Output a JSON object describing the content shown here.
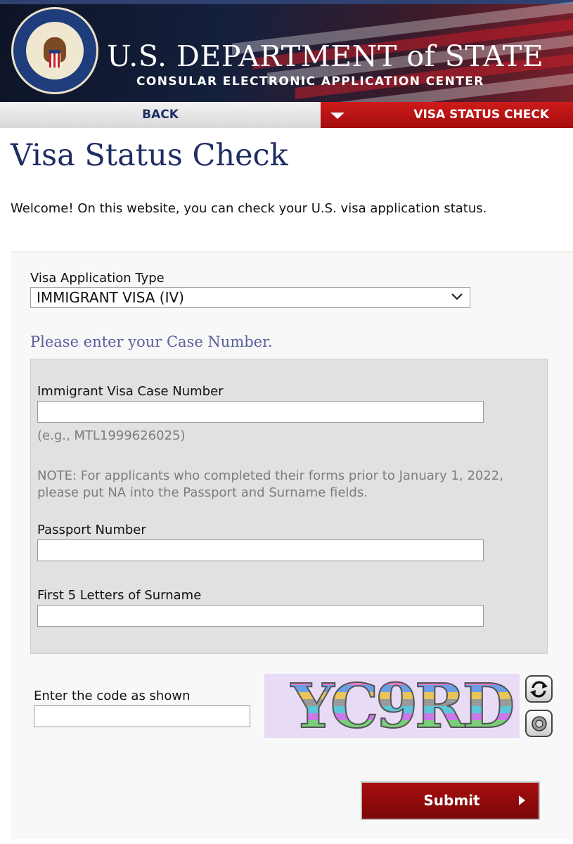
{
  "header": {
    "title_main": "U.S. DEPARTMENT of STATE",
    "title_sub": "CONSULAR ELECTRONIC APPLICATION CENTER",
    "seal_icon": "department-of-state-seal"
  },
  "nav": {
    "back_label": "BACK",
    "status_label": "VISA STATUS CHECK",
    "caret_icon": "caret-down-icon"
  },
  "page": {
    "title": "Visa Status Check",
    "welcome": "Welcome! On this website, you can check your U.S. visa application status."
  },
  "form": {
    "application_type_label": "Visa Application Type",
    "application_type_value": "IMMIGRANT VISA (IV)",
    "prompt": "Please enter your Case Number.",
    "case_number_label": "Immigrant Visa Case Number",
    "case_number_value": "",
    "case_number_hint": "(e.g., MTL1999626025)",
    "note": "NOTE: For applicants who completed their forms prior to January 1, 2022, please put NA into the Passport and Surname fields.",
    "passport_label": "Passport Number",
    "passport_value": "",
    "surname_label": "First 5 Letters of Surname",
    "surname_value": "",
    "captcha_label": "Enter the code as shown",
    "captcha_value": "",
    "captcha_text": "YC9RD",
    "refresh_icon": "refresh-icon",
    "audio_icon": "speaker-icon",
    "submit_label": "Submit"
  },
  "colors": {
    "brand_navy": "#1f2d63",
    "nav_red": "#c01414",
    "submit_red": "#8a0b0b"
  }
}
